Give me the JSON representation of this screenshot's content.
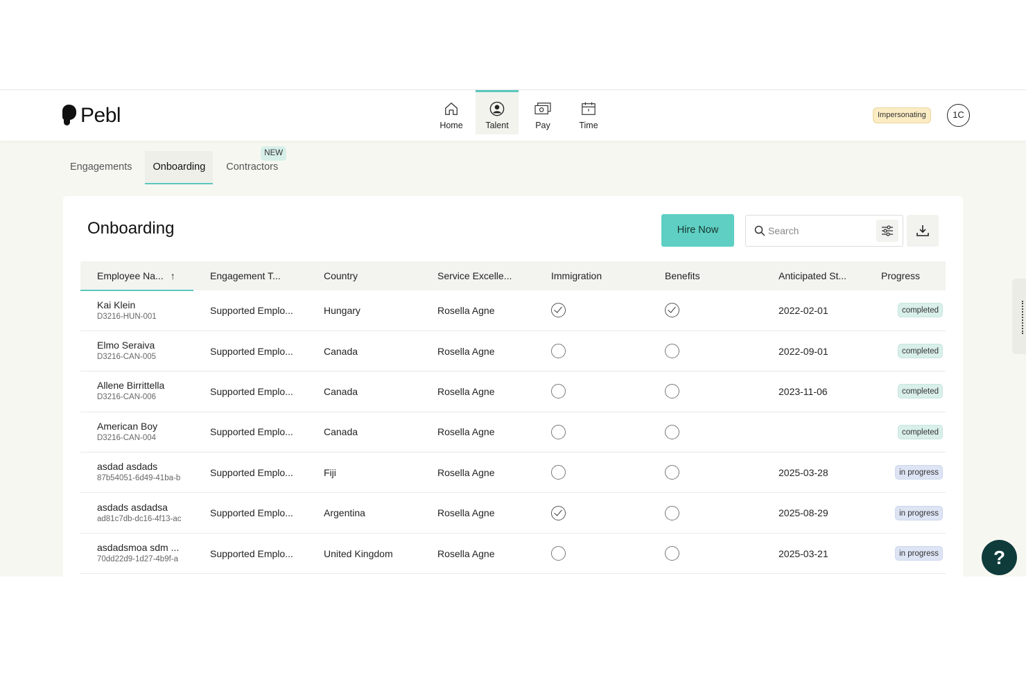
{
  "brand": {
    "name": "Pebl"
  },
  "nav": [
    {
      "label": "Home",
      "icon": "home-icon",
      "active": false
    },
    {
      "label": "Talent",
      "icon": "person-icon",
      "active": true
    },
    {
      "label": "Pay",
      "icon": "money-icon",
      "active": false
    },
    {
      "label": "Time",
      "icon": "calendar-icon",
      "active": false
    }
  ],
  "header": {
    "impersonating": "Impersonating",
    "avatar_initials": "1C"
  },
  "tabs": [
    {
      "label": "Engagements",
      "active": false
    },
    {
      "label": "Onboarding",
      "active": true
    },
    {
      "label": "Contractors",
      "active": false,
      "badge": "NEW"
    }
  ],
  "page": {
    "title": "Onboarding",
    "hire_label": "Hire Now",
    "search_placeholder": "Search"
  },
  "table": {
    "columns": [
      "Employee Na...",
      "Engagement T...",
      "Country",
      "Service Excelle...",
      "Immigration",
      "Benefits",
      "Anticipated St...",
      "Progress"
    ],
    "rows": [
      {
        "name": "Kai Klein",
        "id": "D3216-HUN-001",
        "engagement": "Supported Emplo...",
        "country": "Hungary",
        "service": "Rosella Agne",
        "immigration": true,
        "benefits": true,
        "start": "2022-02-01",
        "progress": "completed"
      },
      {
        "name": "Elmo Seraiva",
        "id": "D3216-CAN-005",
        "engagement": "Supported Emplo...",
        "country": "Canada",
        "service": "Rosella Agne",
        "immigration": false,
        "benefits": false,
        "start": "2022-09-01",
        "progress": "completed"
      },
      {
        "name": "Allene Birrittella",
        "id": "D3216-CAN-006",
        "engagement": "Supported Emplo...",
        "country": "Canada",
        "service": "Rosella Agne",
        "immigration": false,
        "benefits": false,
        "start": "2023-11-06",
        "progress": "completed"
      },
      {
        "name": "American Boy",
        "id": "D3216-CAN-004",
        "engagement": "Supported Emplo...",
        "country": "Canada",
        "service": "Rosella Agne",
        "immigration": false,
        "benefits": false,
        "start": "",
        "progress": "completed"
      },
      {
        "name": "asdad asdads",
        "id": "87b54051-6d49-41ba-b",
        "engagement": "Supported Emplo...",
        "country": "Fiji",
        "service": "Rosella Agne",
        "immigration": false,
        "benefits": false,
        "start": "2025-03-28",
        "progress": "in progress"
      },
      {
        "name": "asdads asdadsa",
        "id": "ad81c7db-dc16-4f13-ac",
        "engagement": "Supported Emplo...",
        "country": "Argentina",
        "service": "Rosella Agne",
        "immigration": true,
        "benefits": false,
        "start": "2025-08-29",
        "progress": "in progress"
      },
      {
        "name": "asdadsmoa sdm ...",
        "id": "70dd22d9-1d27-4b9f-a",
        "engagement": "Supported Emplo...",
        "country": "United Kingdom",
        "service": "Rosella Agne",
        "immigration": false,
        "benefits": false,
        "start": "2025-03-21",
        "progress": "in progress"
      }
    ]
  },
  "help": {
    "label": "?"
  },
  "colors": {
    "accent": "#5ac8bd",
    "hire_button": "#5ecfc2",
    "help_button": "#0f3b3b"
  }
}
